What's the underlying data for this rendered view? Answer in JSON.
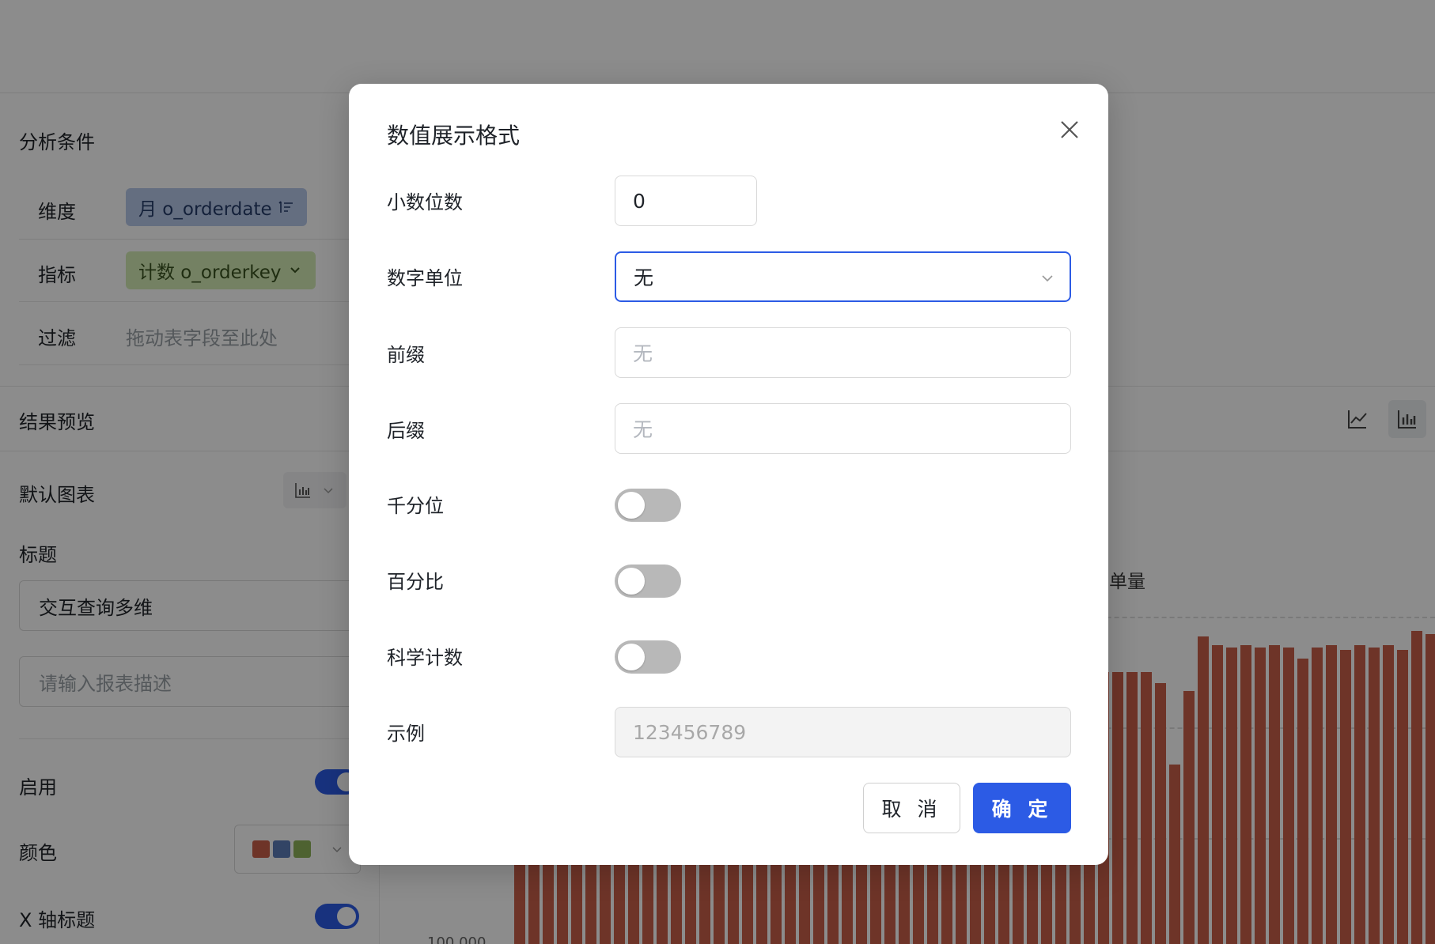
{
  "background": {
    "analysis": {
      "title": "分析条件",
      "dimension_label": "维度",
      "dimension_chip": "月 o_orderdate",
      "metric_label": "指标",
      "metric_chip": "计数 o_orderkey",
      "filter_label": "过滤",
      "filter_placeholder": "拖动表字段至此处"
    },
    "preview": {
      "title": "结果预览"
    },
    "settings": {
      "default_chart_label": "默认图表",
      "title_label": "标题",
      "title_value": "交互查询多维",
      "description_placeholder": "请输入报表描述",
      "enable_label": "启用",
      "color_label": "颜色",
      "x_axis_title_label": "X 轴标题"
    },
    "chart": {
      "y_label_partial": "单量",
      "axis_tick_partial": "100,000",
      "palette": [
        "#c85f4a",
        "#5b7cb8",
        "#8fb35a"
      ]
    }
  },
  "chart_data": {
    "type": "bar",
    "values": [
      100,
      100,
      100,
      100,
      100,
      100,
      100,
      100,
      100,
      100,
      100,
      100,
      100,
      100,
      100,
      100,
      100,
      100,
      100,
      100,
      100,
      100,
      100,
      100,
      100,
      100,
      100,
      100,
      100,
      100,
      100,
      100,
      100,
      100,
      100,
      100,
      100,
      100,
      100,
      100,
      100,
      100,
      100,
      100,
      100,
      96,
      66,
      93,
      113,
      110,
      109,
      110,
      109,
      110,
      109,
      105,
      109,
      110,
      108,
      110,
      109,
      110,
      108,
      115,
      114,
      118
    ],
    "title": "",
    "xlabel": "",
    "ylabel": "",
    "color": "#c85f4a"
  },
  "modal": {
    "title": "数值展示格式",
    "decimal_label": "小数位数",
    "decimal_value": "0",
    "unit_label": "数字单位",
    "unit_value": "无",
    "prefix_label": "前缀",
    "prefix_placeholder": "无",
    "suffix_label": "后缀",
    "suffix_placeholder": "无",
    "thousands_label": "千分位",
    "percent_label": "百分比",
    "scientific_label": "科学计数",
    "example_label": "示例",
    "example_value": "123456789",
    "cancel_label": "取 消",
    "ok_label": "确 定",
    "accent_color": "#2c5be5"
  }
}
